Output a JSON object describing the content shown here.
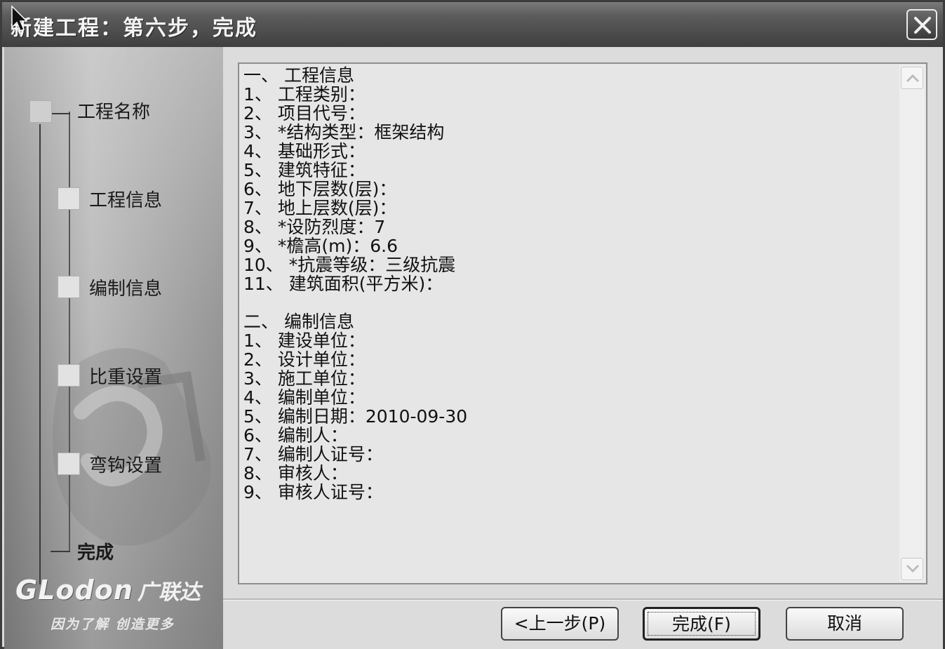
{
  "window": {
    "title": "新建工程：第六步，完成"
  },
  "sidebar": {
    "steps": [
      {
        "label": "工程名称"
      },
      {
        "label": "工程信息"
      },
      {
        "label": "编制信息"
      },
      {
        "label": "比重设置"
      },
      {
        "label": "弯钩设置"
      },
      {
        "label": "完成"
      }
    ],
    "logo": {
      "brand": "GLodon",
      "brand_cn": "广联达",
      "slogan": "因为了解 创造更多"
    }
  },
  "summary": {
    "lines": [
      "一、 工程信息",
      "1、 工程类别：",
      "2、 项目代号：",
      "3、 *结构类型：框架结构",
      "4、 基础形式：",
      "5、 建筑特征：",
      "6、 地下层数(层)：",
      "7、 地上层数(层)：",
      "8、 *设防烈度：7",
      "9、 *檐高(m)：6.6",
      "10、 *抗震等级：三级抗震",
      "11、 建筑面积(平方米)：",
      "",
      "二、 编制信息",
      "1、 建设单位：",
      "2、 设计单位：",
      "3、 施工单位：",
      "4、 编制单位：",
      "5、 编制日期：2010-09-30",
      "6、 编制人：",
      "7、 编制人证号：",
      "8、 审核人：",
      "9、 审核人证号："
    ]
  },
  "buttons": {
    "prev": "<上一步(P)",
    "finish": "完成(F)",
    "cancel": "取消"
  },
  "icons": {
    "close": "close-icon",
    "cursor": "mouse-cursor-icon",
    "scroll_up": "chevron-up-icon",
    "scroll_down": "chevron-down-icon"
  }
}
